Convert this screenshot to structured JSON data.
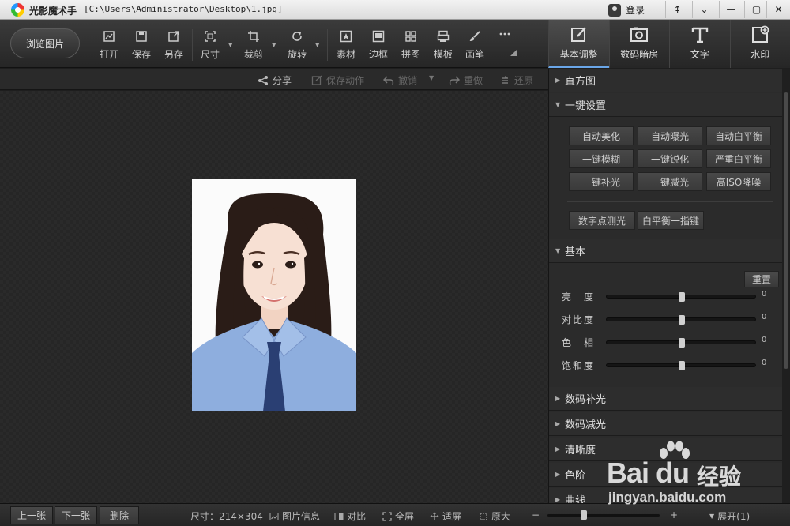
{
  "window": {
    "app_title": "光影魔术手",
    "file_path": "[C:\\Users\\Administrator\\Desktop\\1.jpg]",
    "login_label": "登录",
    "controls": [
      "⇞",
      "⌄",
      "—",
      "▢",
      "✕"
    ]
  },
  "toolbar": {
    "browse_label": "浏览图片",
    "tools": [
      {
        "label": "打开",
        "icon": "open-icon"
      },
      {
        "label": "保存",
        "icon": "save-icon"
      },
      {
        "label": "另存",
        "icon": "save-as-icon"
      },
      {
        "label": "尺寸",
        "icon": "resize-icon"
      },
      {
        "label": "裁剪",
        "icon": "crop-icon"
      },
      {
        "label": "旋转",
        "icon": "rotate-icon"
      },
      {
        "label": "素材",
        "icon": "material-icon"
      },
      {
        "label": "边框",
        "icon": "frame-icon"
      },
      {
        "label": "拼图",
        "icon": "collage-icon"
      },
      {
        "label": "模板",
        "icon": "template-icon"
      },
      {
        "label": "画笔",
        "icon": "brush-icon"
      },
      {
        "label": "",
        "icon": "more-icon"
      }
    ]
  },
  "panel_tabs": [
    {
      "label": "基本调整",
      "icon": "basic-adjust-icon",
      "active": true
    },
    {
      "label": "数码暗房",
      "icon": "darkroom-icon",
      "active": false
    },
    {
      "label": "文字",
      "icon": "text-icon",
      "active": false
    },
    {
      "label": "水印",
      "icon": "watermark-icon",
      "active": false
    }
  ],
  "actions": {
    "share": "分享",
    "save_action": "保存动作",
    "undo": "撤销",
    "redo": "重做",
    "restore": "还原"
  },
  "right_panel": {
    "histogram": "直方图",
    "one_click": "一键设置",
    "one_click_buttons": [
      "自动美化",
      "自动曝光",
      "自动白平衡",
      "一键模糊",
      "一键锐化",
      "严重白平衡",
      "一键补光",
      "一键减光",
      "高ISO降噪"
    ],
    "extra_buttons": [
      "数字点测光",
      "白平衡一指键"
    ],
    "basic": "基本",
    "reset": "重置",
    "sliders": [
      {
        "label": "亮　度",
        "value": "0"
      },
      {
        "label": "对比度",
        "value": "0"
      },
      {
        "label": "色　相",
        "value": "0"
      },
      {
        "label": "饱和度",
        "value": "0"
      }
    ],
    "sections": [
      "数码补光",
      "数码减光",
      "清晰度",
      "色阶",
      "曲线"
    ]
  },
  "statusbar": {
    "prev": "上一张",
    "next": "下一张",
    "delete": "删除",
    "size": "尺寸：214×304",
    "image_info": "图片信息",
    "compare": "对比",
    "fullscreen": "全屏",
    "fit": "适屏",
    "original": "原大",
    "zoom_minus": "−",
    "zoom_plus": "+",
    "expand": "展开(1)"
  },
  "watermark": {
    "brand": "Bai du",
    "cn": "经验",
    "url": "jingyan.baidu.com"
  },
  "colors": {
    "accent": "#6aa6e8",
    "shirt": "#8eaede",
    "tie": "#2a3f73",
    "hair": "#2a1c17"
  }
}
